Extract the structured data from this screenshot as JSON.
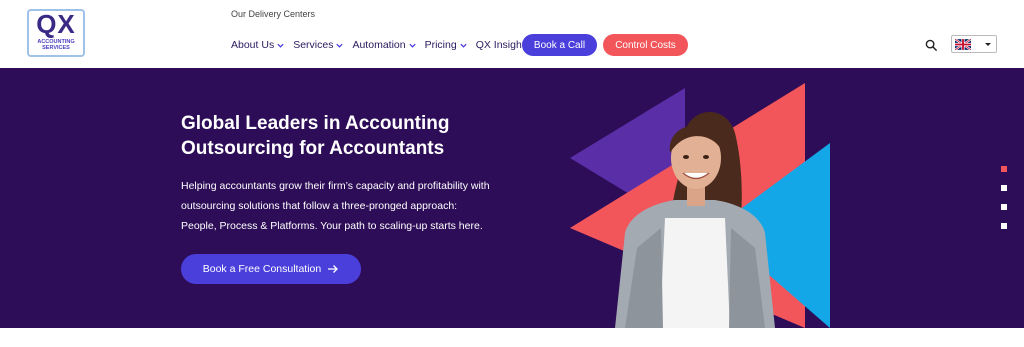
{
  "logo": {
    "mark": "QX",
    "subtitle": "ACCOUNTING SERVICES"
  },
  "header": {
    "top_link": "Our Delivery Centers",
    "nav": [
      {
        "label": "About Us",
        "dropdown": true
      },
      {
        "label": "Services",
        "dropdown": true
      },
      {
        "label": "Automation",
        "dropdown": true
      },
      {
        "label": "Pricing",
        "dropdown": true
      },
      {
        "label": "QX Insight",
        "dropdown": true
      }
    ],
    "book_call": "Book a Call",
    "control_costs": "Control Costs",
    "language_flag": "uk-flag-icon"
  },
  "hero": {
    "title_line1": "Global Leaders in Accounting",
    "title_line2": "Outsourcing for Accountants",
    "text_line1": "Helping accountants grow their firm’s capacity and profitability with",
    "text_line2": "outsourcing solutions that follow a three-pronged approach:",
    "text_line3": "People, Process & Platforms. Your path to scaling-up starts here.",
    "cta": "Book a Free Consultation"
  },
  "slider": {
    "slides": 4,
    "active": 1
  },
  "colors": {
    "hero_bg": "#2d0d57",
    "primary": "#4b3fdc",
    "accent": "#f2555a",
    "triangle_purple": "#5a2ea6",
    "triangle_blue": "#14a7e8"
  }
}
